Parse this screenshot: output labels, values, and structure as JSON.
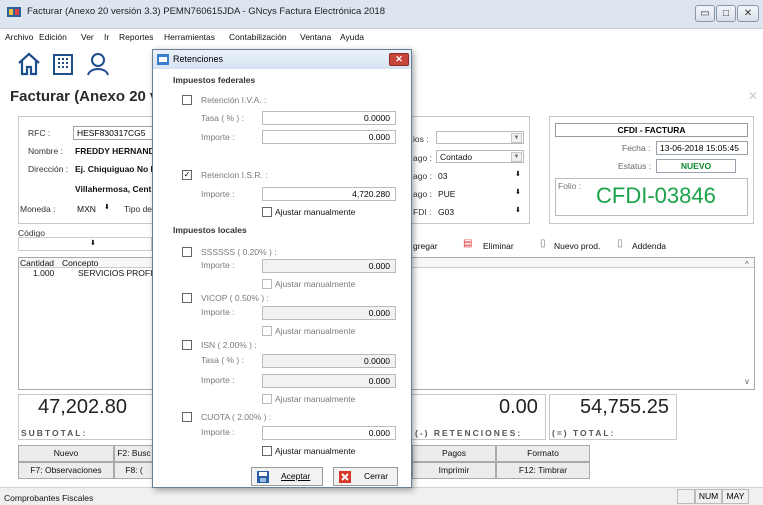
{
  "window": {
    "title": "Facturar (Anexo 20 versión 3.3) PEMN760615JDA - GNcys Factura Electrónica 2018",
    "min": "▭",
    "max": "□",
    "close": "✕"
  },
  "menu": [
    "Archivo",
    "Edición",
    "Ver",
    "Ir",
    "Reportes",
    "Herramientas",
    "Contabilización",
    "Ventana",
    "Ayuda"
  ],
  "form": {
    "title": "Facturar (Anexo 20 ve",
    "rfc_label": "RFC :",
    "rfc_value": "HESF830317CG5",
    "nombre_label": "Nombre :",
    "nombre_value": "FREDDY HERNANDE",
    "direccion_label": "Dirección :",
    "direccion_value": "Ej. Chiquiguao No I",
    "direccion2": "Villahermosa, Cent",
    "moneda_label": "Moneda :",
    "moneda_value": "MXN",
    "tipo_label": "Tipo de",
    "codigo_label": "Código",
    "right_labels": [
      "ios :",
      "ago :",
      "ago :",
      "ago :",
      "FDI :"
    ],
    "right_values": [
      "",
      "Contado",
      "03",
      "PUE",
      "G03"
    ]
  },
  "cfdi": {
    "header": "CFDI - FACTURA",
    "fecha_label": "Fecha :",
    "fecha_value": "13-06-2018 15:05:45",
    "estatus_label": "Estatus :",
    "estatus_value": "NUEVO",
    "folio_label": "Folio :",
    "folio_value": "CFDI-03846"
  },
  "toolbar": {
    "agregar": "gregar",
    "eliminar": "Eliminar",
    "nuevo": "Nuevo prod.",
    "addenda": "Addenda"
  },
  "grid": {
    "headers": [
      "Cantidad",
      "Concepto"
    ],
    "rows": [
      {
        "cantidad": "1.000",
        "concepto": "SERVICIOS PROFI"
      }
    ]
  },
  "totals": {
    "subtotal_value": "47,202.80",
    "subtotal_label": "SUBTOTAL:",
    "retenciones_value": "0.00",
    "retenciones_label": "(-) RETENCIONES:",
    "total_value": "54,755.25",
    "total_label": "(=) TOTAL:"
  },
  "buttons": {
    "nuevo": "Nuevo",
    "f2": "F2: Busc",
    "obs": "F7: Observaciones",
    "f8": "F8: (",
    "pagos": "Pagos",
    "formato": "Formato",
    "imprimir": "Imprimir",
    "timbrar": "F12: Timbrar"
  },
  "status": {
    "left": "Comprobantes Fiscales",
    "num": "NUM",
    "may": "MAY"
  },
  "dialog": {
    "title": "Retenciones",
    "federales": "Impuestos federales",
    "ret_iva": "Retención I.V.A. :",
    "tasa": "Tasa ( % ) :",
    "iva_tasa": "0.0000",
    "importe": "Importe :",
    "iva_importe": "0.000",
    "ret_isr": "Retencion I.S.R. :",
    "isr_importe": "4,720.280",
    "ajustar": "Ajustar manualmente",
    "locales": "Impuestos locales",
    "ssssss": "SSSSSS ( 0.20% ) :",
    "ssssss_importe": "0.000",
    "vicop": "VICOP ( 0.50% ) :",
    "vicop_importe": "0.000",
    "isn": "ISN ( 2.00% ) :",
    "isn_tasa": "0.0000",
    "isn_importe": "0.000",
    "cuota": "CUOTA ( 2.00% ) :",
    "cuota_importe": "0.000",
    "aceptar": "Aceptar",
    "cerrar": "Cerrar",
    "check": "✓"
  }
}
